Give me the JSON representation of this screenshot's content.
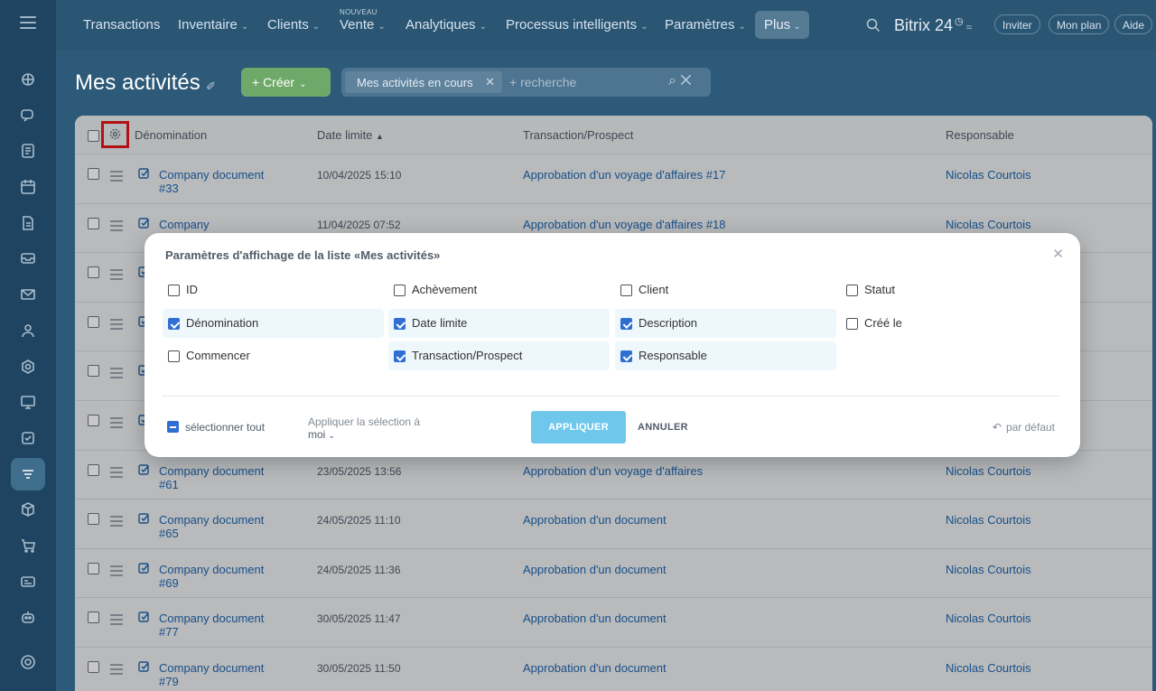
{
  "nav": {
    "items": [
      {
        "label": "Transactions",
        "chevron": false
      },
      {
        "label": "Inventaire",
        "chevron": true
      },
      {
        "label": "Clients",
        "chevron": true
      },
      {
        "label": "Vente",
        "chevron": true
      },
      {
        "label": "Analytiques",
        "chevron": true
      },
      {
        "label": "Processus intelligents",
        "chevron": true
      },
      {
        "label": "Paramètres",
        "chevron": true
      }
    ],
    "new_badge": "NOUVEAU",
    "more_label": "Plus",
    "brand": "Bitrix 24",
    "invite_label": "Inviter",
    "plan_label": "Mon plan",
    "help_label": "Aide"
  },
  "page": {
    "title": "Mes activités",
    "create_label": "+ Créer",
    "filter_tag": "Mes activités en cours",
    "search_placeholder": "+ recherche"
  },
  "grid": {
    "headers": {
      "name": "Dénomination",
      "deadline": "Date limite",
      "deadline_sort": "▲",
      "deal": "Transaction/Prospect",
      "responsible": "Responsable"
    },
    "rows": [
      {
        "name": "Company document #33",
        "date": "10/04/2025 15:10",
        "deal": "Approbation d'un voyage d'affaires #17",
        "responsible": "Nicolas Courtois"
      },
      {
        "name": "Company",
        "date": "11/04/2025 07:52",
        "deal": "Approbation d'un voyage d'affaires #18",
        "responsible": "Nicolas Courtois"
      },
      {
        "name": "",
        "date": "",
        "deal": "",
        "responsible": ""
      },
      {
        "name": "",
        "date": "",
        "deal": "",
        "responsible": ""
      },
      {
        "name": "",
        "date": "",
        "deal": "",
        "responsible": ""
      },
      {
        "name": "",
        "date": "",
        "deal": "",
        "responsible": ""
      },
      {
        "name": "Company document #61",
        "date": "23/05/2025 13:56",
        "deal": "Approbation d'un voyage d'affaires",
        "responsible": "Nicolas Courtois"
      },
      {
        "name": "Company document #65",
        "date": "24/05/2025 11:10",
        "deal": "Approbation d'un document",
        "responsible": "Nicolas Courtois"
      },
      {
        "name": "Company document #69",
        "date": "24/05/2025 11:36",
        "deal": "Approbation d'un document",
        "responsible": "Nicolas Courtois"
      },
      {
        "name": "Company document #77",
        "date": "30/05/2025 11:47",
        "deal": "Approbation d'un document",
        "responsible": "Nicolas Courtois"
      },
      {
        "name": "Company document #79",
        "date": "30/05/2025 11:50",
        "deal": "Approbation d'un document",
        "responsible": "Nicolas Courtois"
      }
    ]
  },
  "modal": {
    "title": "Paramètres d'affichage de la liste «Mes activités»",
    "options": [
      {
        "label": "ID",
        "checked": false
      },
      {
        "label": "Achèvement",
        "checked": false
      },
      {
        "label": "Client",
        "checked": false
      },
      {
        "label": "Statut",
        "checked": false
      },
      {
        "label": "Dénomination",
        "checked": true
      },
      {
        "label": "Date limite",
        "checked": true
      },
      {
        "label": "Description",
        "checked": true
      },
      {
        "label": "Créé le",
        "checked": false
      },
      {
        "label": "Commencer",
        "checked": false
      },
      {
        "label": "Transaction/Prospect",
        "checked": true
      },
      {
        "label": "Responsable",
        "checked": true
      }
    ],
    "select_all_label": "sélectionner tout",
    "apply_to_label": "Appliquer la sélection à",
    "apply_to_value": "moi",
    "apply_label": "APPLIQUER",
    "cancel_label": "ANNULER",
    "reset_label": "par défaut"
  },
  "colors": {
    "accent": "#2f6fd2",
    "apply_button": "#6fc8ec",
    "create_button": "#6fa96a",
    "highlight_box": "#e3161b"
  }
}
